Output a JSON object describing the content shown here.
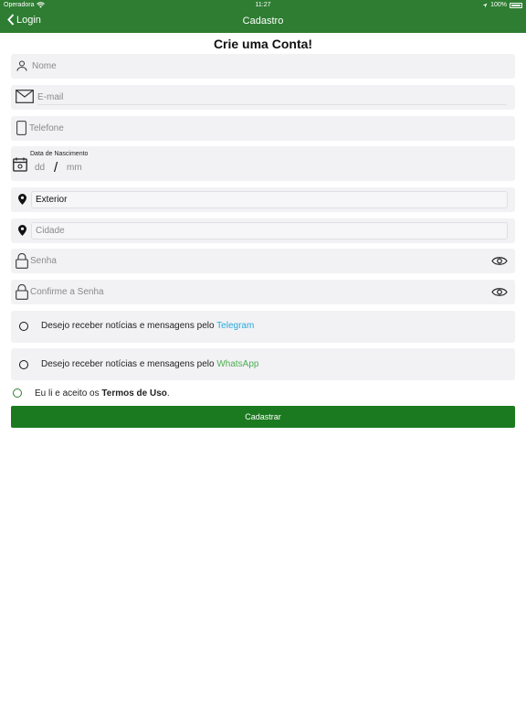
{
  "status_bar": {
    "carrier": "Operadora",
    "time": "11:27",
    "battery": "100%"
  },
  "nav": {
    "back_label": "Login",
    "title": "Cadastro"
  },
  "form": {
    "heading": "Crie uma Conta!",
    "name_placeholder": "Nome",
    "email_placeholder": "E-mail",
    "phone_placeholder": "Telefone",
    "birth": {
      "label": "Data de Nascimento",
      "day_placeholder": "dd",
      "separator": "/",
      "month_placeholder": "mm"
    },
    "country_value": "Exterior",
    "city_placeholder": "Cidade",
    "password_placeholder": "Senha",
    "confirm_password_placeholder": "Confirme a Senha",
    "telegram_optin": {
      "text": "Desejo receber notícias e mensagens pelo ",
      "link": "Telegram"
    },
    "whatsapp_optin": {
      "text": "Desejo receber notícias e mensagens pelo ",
      "link": "WhatsApp"
    },
    "terms": {
      "prefix": "Eu li e aceito os ",
      "link": "Termos de Uso",
      "suffix": "."
    },
    "submit_label": "Cadastrar"
  },
  "colors": {
    "header": "#2e7d32",
    "button": "#1b7a1f",
    "telegram": "#2aa8d8",
    "whatsapp": "#4caf50",
    "field_bg": "#f2f2f5"
  },
  "icons": [
    "chevron-left-icon",
    "wifi-icon",
    "location-arrow-icon",
    "battery-icon",
    "user-icon",
    "envelope-icon",
    "phone-icon",
    "calendar-icon",
    "map-pin-icon",
    "lock-icon",
    "eye-icon"
  ]
}
